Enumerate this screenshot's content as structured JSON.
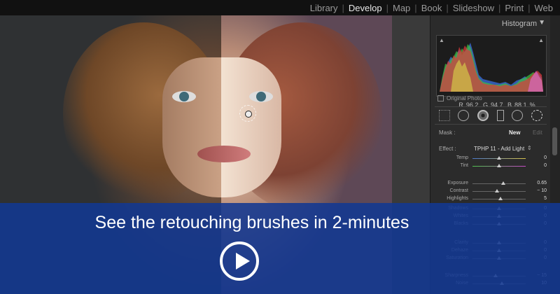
{
  "modules": [
    "Library",
    "Develop",
    "Map",
    "Book",
    "Slideshow",
    "Print",
    "Web"
  ],
  "active_module": "Develop",
  "histogram": {
    "title": "Histogram",
    "r_label": "R",
    "r_value": "96.2",
    "g_label": "G",
    "g_value": "94.7",
    "b_label": "B",
    "b_value": "88.1",
    "percent": "%",
    "original_photo": "Original Photo"
  },
  "mask": {
    "label": "Mask :",
    "new": "New",
    "edit": "Edit"
  },
  "effect": {
    "label": "Effect :",
    "value": "TPHP 11 - Add Light"
  },
  "sliders": [
    {
      "label": "Temp",
      "value": "0",
      "level": 0.5
    },
    {
      "label": "Tint",
      "value": "0",
      "level": 0.5
    },
    {
      "label": "Exposure",
      "value": "0.65",
      "level": 0.58
    },
    {
      "label": "Contrast",
      "value": "− 10",
      "level": 0.46
    },
    {
      "label": "Highlights",
      "value": "5",
      "level": 0.52
    },
    {
      "label": "Shadows",
      "value": "0",
      "level": 0.5
    },
    {
      "label": "Whites",
      "value": "0",
      "level": 0.5
    },
    {
      "label": "Blacks",
      "value": "0",
      "level": 0.5
    },
    {
      "label": "Clarity",
      "value": "0",
      "level": 0.5
    },
    {
      "label": "Dehaze",
      "value": "0",
      "level": 0.5
    },
    {
      "label": "Saturation",
      "value": "0",
      "level": 0.5
    },
    {
      "label": "Sharpness",
      "value": "− 15",
      "level": 0.44
    },
    {
      "label": "Noise",
      "value": "10",
      "level": 0.55
    }
  ],
  "banner": {
    "text": "See the retouching brushes in 2-minutes"
  },
  "colors": {
    "banner_bg": "#123892",
    "panel_bg": "#2b2b2b",
    "topbar_bg": "#111111"
  },
  "icons": [
    "play-icon",
    "histogram-collapse-icon",
    "crop-overlay-icon",
    "spot-removal-icon",
    "red-eye-icon",
    "graduated-filter-icon",
    "radial-filter-icon",
    "adjustment-brush-icon"
  ]
}
